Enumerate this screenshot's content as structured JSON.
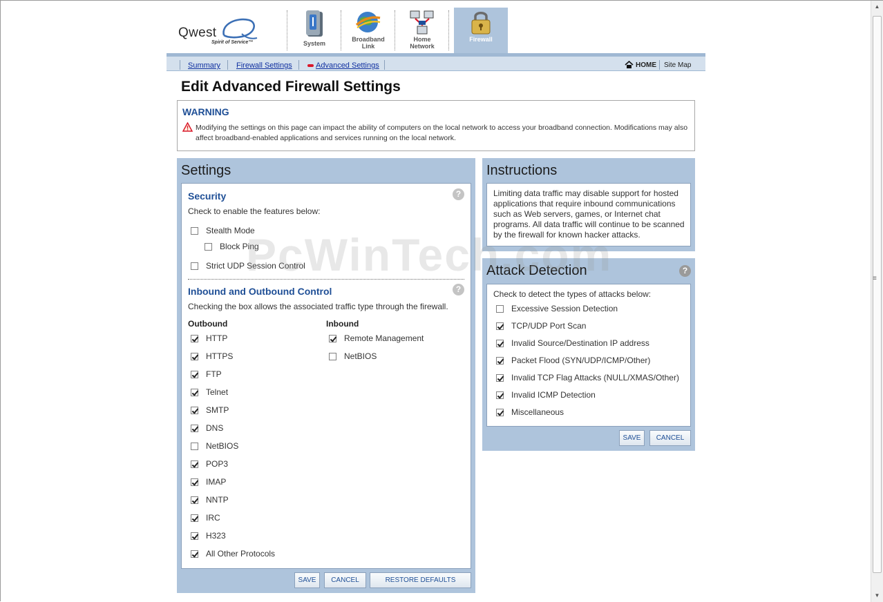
{
  "logo": {
    "brand": "Qwest",
    "tagline": "Spirit of Service™"
  },
  "nav_tabs": [
    {
      "label_lines": [
        "System"
      ],
      "icon": "system-icon"
    },
    {
      "label_lines": [
        "Broadband",
        "Link"
      ],
      "icon": "broadband-globe-icon"
    },
    {
      "label_lines": [
        "Home",
        "Network"
      ],
      "icon": "home-network-icon"
    },
    {
      "label_lines": [
        "Firewall"
      ],
      "icon": "padlock-icon",
      "active": true
    }
  ],
  "subnav": {
    "links": [
      "Summary",
      "Firewall Settings",
      "Advanced Settings"
    ],
    "active": "Advanced Settings",
    "home_label": "HOME",
    "sitemap_label": "Site Map"
  },
  "page_title": "Edit Advanced Firewall Settings",
  "warning": {
    "title": "WARNING",
    "text": "Modifying the settings on this page can impact the ability of computers on the local network to access your broadband connection. Modifications may also affect broadband-enabled applications and services running on the local network."
  },
  "settings": {
    "title": "Settings",
    "security": {
      "title": "Security",
      "desc": "Check to enable the features below:",
      "options": [
        {
          "label": "Stealth Mode",
          "checked": false
        },
        {
          "label": "Block Ping",
          "checked": false
        },
        {
          "label": "Strict UDP Session Control",
          "checked": false
        }
      ]
    },
    "control": {
      "title": "Inbound and Outbound Control",
      "desc": "Checking the box allows the associated traffic type through the firewall.",
      "outbound_label": "Outbound",
      "inbound_label": "Inbound",
      "outbound": [
        {
          "label": "HTTP",
          "checked": true
        },
        {
          "label": "HTTPS",
          "checked": true
        },
        {
          "label": "FTP",
          "checked": true
        },
        {
          "label": "Telnet",
          "checked": true
        },
        {
          "label": "SMTP",
          "checked": true
        },
        {
          "label": "DNS",
          "checked": true
        },
        {
          "label": "NetBIOS",
          "checked": false
        },
        {
          "label": "POP3",
          "checked": true
        },
        {
          "label": "IMAP",
          "checked": true
        },
        {
          "label": "NNTP",
          "checked": true
        },
        {
          "label": "IRC",
          "checked": true
        },
        {
          "label": "H323",
          "checked": true
        },
        {
          "label": "All Other Protocols",
          "checked": true
        }
      ],
      "inbound": [
        {
          "label": "Remote Management",
          "checked": true
        },
        {
          "label": "NetBIOS",
          "checked": false
        }
      ]
    },
    "buttons": {
      "save": "SAVE",
      "cancel": "CANCEL",
      "restore": "RESTORE DEFAULTS"
    }
  },
  "instructions": {
    "title": "Instructions",
    "text": "Limiting data traffic may disable support for hosted applications that require inbound communications such as Web servers, games, or Internet chat programs. All data traffic will continue to be scanned by the firewall for known hacker attacks."
  },
  "attack": {
    "title": "Attack Detection",
    "desc": "Check to detect the types of attacks below:",
    "options": [
      {
        "label": "Excessive Session Detection",
        "checked": false
      },
      {
        "label": "TCP/UDP Port Scan",
        "checked": true
      },
      {
        "label": "Invalid Source/Destination IP address",
        "checked": true
      },
      {
        "label": "Packet Flood (SYN/UDP/ICMP/Other)",
        "checked": true
      },
      {
        "label": "Invalid TCP Flag Attacks (NULL/XMAS/Other)",
        "checked": true
      },
      {
        "label": "Invalid ICMP Detection",
        "checked": true
      },
      {
        "label": "Miscellaneous",
        "checked": true
      }
    ],
    "buttons": {
      "save": "SAVE",
      "cancel": "CANCEL"
    }
  },
  "watermark": "PcWinTech.com",
  "help_glyph": "?",
  "colors": {
    "panel_bg": "#aec4dc",
    "title_blue": "#1f4f96",
    "subnav_bg": "#d4e0ed",
    "warning_red": "#d9182b"
  }
}
